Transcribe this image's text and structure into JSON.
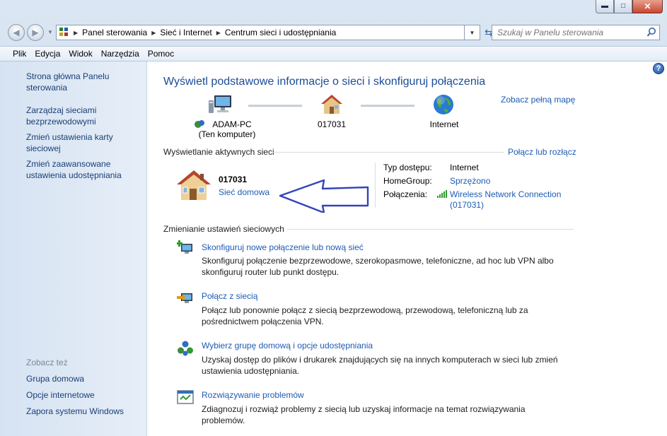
{
  "address": {
    "crumbs": [
      "Panel sterowania",
      "Sieć i Internet",
      "Centrum sieci i udostępniania"
    ],
    "search_placeholder": "Szukaj w Panelu sterowania"
  },
  "menu": [
    "Plik",
    "Edycja",
    "Widok",
    "Narzędzia",
    "Pomoc"
  ],
  "sidebar": {
    "items": [
      "Strona główna Panelu sterowania",
      "Zarządzaj sieciami bezprzewodowymi",
      "Zmień ustawienia karty sieciowej",
      "Zmień zaawansowane ustawienia udostępniania"
    ],
    "see_also_heading": "Zobacz też",
    "see_also": [
      "Grupa domowa",
      "Opcje internetowe",
      "Zapora systemu Windows"
    ]
  },
  "main": {
    "title": "Wyświetl podstawowe informacje o sieci i skonfiguruj połączenia",
    "full_map_link": "Zobacz pełną mapę",
    "map": {
      "computer_name": "ADAM-PC",
      "computer_sub": "(Ten komputer)",
      "network_name": "017031",
      "internet_label": "Internet"
    },
    "active_heading": "Wyświetlanie aktywnych sieci",
    "connect_link": "Połącz lub rozłącz",
    "active_network": {
      "name": "017031",
      "type": "Sieć domowa",
      "access_label": "Typ dostępu:",
      "access_value": "Internet",
      "homegroup_label": "HomeGroup:",
      "homegroup_value": "Sprzężono",
      "connections_label": "Połączenia:",
      "connection_line1": "Wireless Network Connection",
      "connection_line2": "(017031)"
    },
    "change_heading": "Zmienianie ustawień sieciowych",
    "tasks": [
      {
        "title": "Skonfiguruj nowe połączenie lub nową sieć",
        "desc": "Skonfiguruj połączenie bezprzewodowe, szerokopasmowe, telefoniczne, ad hoc lub VPN albo skonfiguruj router lub punkt dostępu."
      },
      {
        "title": "Połącz z siecią",
        "desc": "Połącz lub ponownie połącz z siecią bezprzewodową, przewodową, telefoniczną lub za pośrednictwem połączenia VPN."
      },
      {
        "title": "Wybierz grupę domową i opcje udostępniania",
        "desc": "Uzyskaj dostęp do plików i drukarek znajdujących się na innych komputerach w sieci lub zmień ustawienia udostępniania."
      },
      {
        "title": "Rozwiązywanie problemów",
        "desc": "Zdiagnozuj i rozwiąż problemy z siecią lub uzyskaj informacje na temat rozwiązywania problemów."
      }
    ]
  },
  "icons": {
    "link_color": "#1d5cb3",
    "title_color": "#1b4c96",
    "arrow_color": "#3344bb"
  }
}
